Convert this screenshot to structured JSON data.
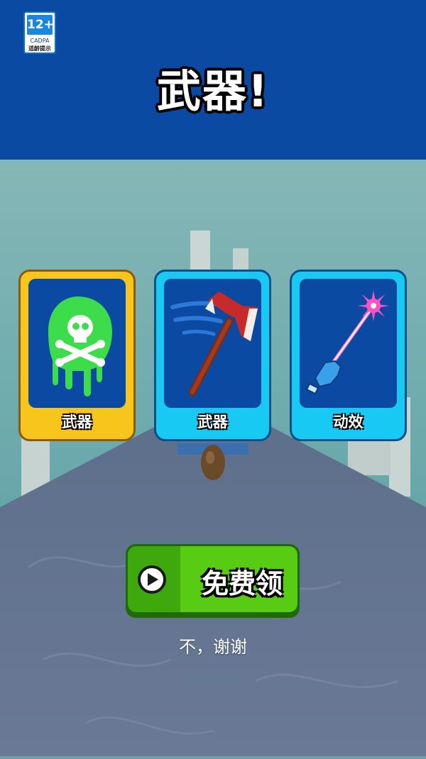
{
  "header": {
    "age_rating": "12+",
    "age_org": "CADPA",
    "age_hint": "适龄提示",
    "title": "武器!"
  },
  "cards": [
    {
      "label": "武器",
      "icon": "toxic-skull-icon",
      "selected": true
    },
    {
      "label": "武器",
      "icon": "axe-icon",
      "selected": false
    },
    {
      "label": "动效",
      "icon": "magic-wand-glove-icon",
      "selected": false
    }
  ],
  "claim": {
    "label": "免费领",
    "icon": "play-icon"
  },
  "decline": {
    "label": "不，谢谢"
  },
  "colors": {
    "header_bg": "#0b4aa3",
    "card_selected": "#f7c51c",
    "card_normal": "#17c9f3",
    "button_green": "#58cc12"
  }
}
